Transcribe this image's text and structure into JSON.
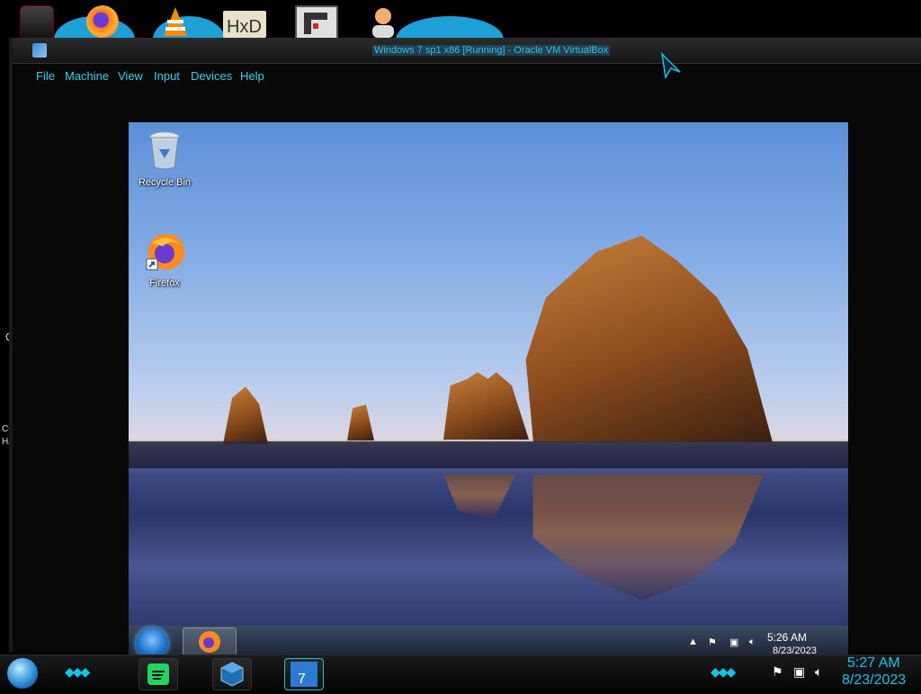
{
  "host": {
    "dock_icons": [
      {
        "name": "app-1"
      },
      {
        "name": "firefox"
      },
      {
        "name": "vlc"
      },
      {
        "name": "hxd"
      },
      {
        "name": "app-5"
      },
      {
        "name": "user-app"
      }
    ],
    "left_edge": {
      "t1": "C",
      "t2": "CC",
      "t3": "HA"
    },
    "taskbar": {
      "time": "5:27 AM",
      "date": "8/23/2023",
      "pinned": [
        {
          "name": "spotify"
        },
        {
          "name": "virtualbox"
        },
        {
          "name": "windows-7-vm",
          "label": "7"
        }
      ]
    }
  },
  "vbox": {
    "title": "Windows 7 sp1 x86 [Running] - Oracle VM VirtualBox",
    "menu": [
      "File",
      "Machine",
      "View",
      "Input",
      "Devices",
      "Help"
    ]
  },
  "guest": {
    "desktop_icons": [
      {
        "label": "Recycle Bin",
        "icon": "recycle-bin-icon"
      },
      {
        "label": "Firefox",
        "icon": "firefox-icon"
      }
    ],
    "taskbar": {
      "time": "5:26 AM",
      "date": "8/23/2023"
    },
    "colors": {
      "sky_top": "#5d8fd8",
      "rock": "#c9823a",
      "water": "#2a356a"
    }
  },
  "colors": {
    "accent": "#18c3e8",
    "menu": "#2fd0f0"
  }
}
